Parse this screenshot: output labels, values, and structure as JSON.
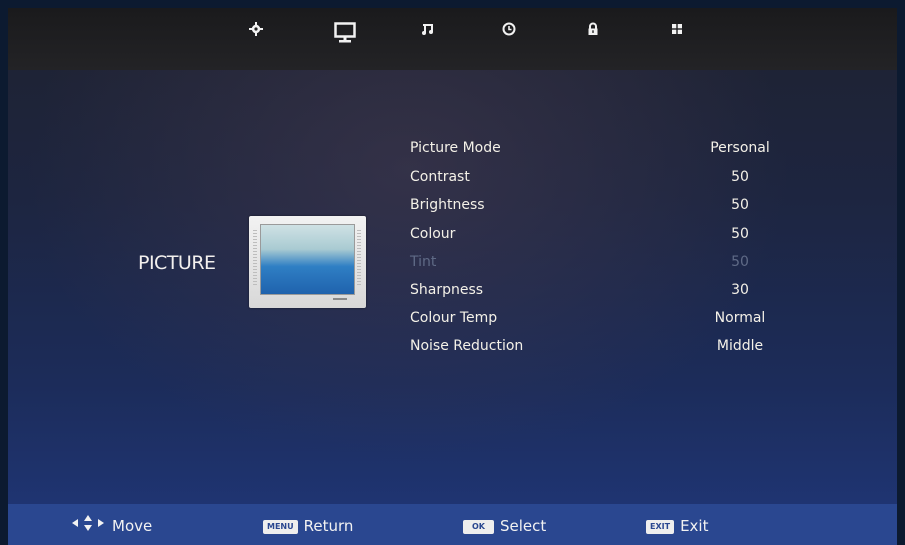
{
  "top_menu": {
    "items": [
      {
        "icon": "gear-icon"
      },
      {
        "icon": "monitor-icon",
        "active": true
      },
      {
        "icon": "music-note-icon"
      },
      {
        "icon": "clock-icon"
      },
      {
        "icon": "lock-icon"
      },
      {
        "icon": "grid-icon"
      }
    ]
  },
  "section": {
    "title": "PICTURE"
  },
  "settings": [
    {
      "label": "Picture Mode",
      "value": "Personal"
    },
    {
      "label": "Contrast",
      "value": "50"
    },
    {
      "label": "Brightness",
      "value": "50"
    },
    {
      "label": "Colour",
      "value": "50"
    },
    {
      "label": "Tint",
      "value": "50",
      "disabled": true
    },
    {
      "label": "Sharpness",
      "value": "30"
    },
    {
      "label": "Colour Temp",
      "value": "Normal"
    },
    {
      "label": "Noise Reduction",
      "value": "Middle"
    }
  ],
  "footer": {
    "move": {
      "label": "Move"
    },
    "return": {
      "key": "MENU",
      "label": "Return"
    },
    "select": {
      "key": "OK",
      "label": "Select"
    },
    "exit": {
      "key": "EXIT",
      "label": "Exit"
    }
  },
  "colors": {
    "bar": "#2a4790",
    "text": "#f4f1e8",
    "disabled": "#5f6a86"
  }
}
